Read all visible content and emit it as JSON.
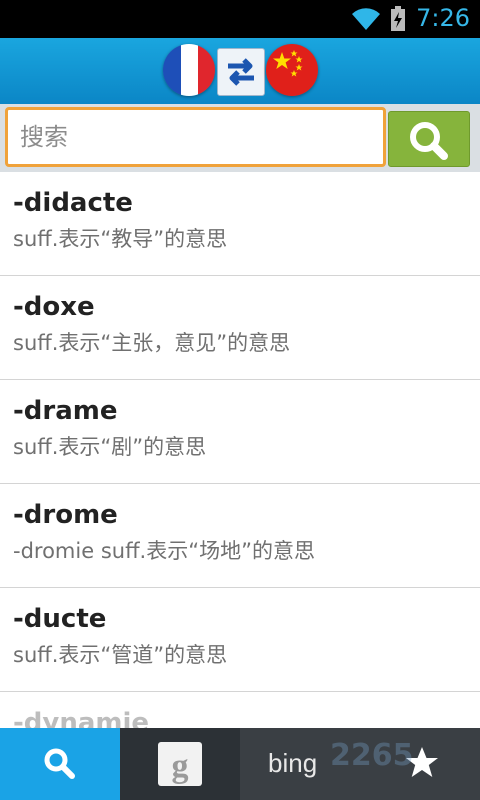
{
  "status_bar": {
    "time": "7:26",
    "icons": [
      "wifi-icon",
      "battery-charging-icon"
    ]
  },
  "header": {
    "source_flag": "france-flag-icon",
    "swap_icon": "swap-arrows-icon",
    "target_flag": "china-flag-icon",
    "accent_color": "#1aa6df"
  },
  "search": {
    "placeholder": "搜索",
    "value": "",
    "button_icon": "search-icon",
    "button_color": "#86b43c",
    "focus_border_color": "#f0a23a"
  },
  "entries": [
    {
      "word": "-didacte",
      "definition": "suff.表示“教导”的意思"
    },
    {
      "word": "-doxe",
      "definition": "suff.表示“主张，意见”的意思"
    },
    {
      "word": "-drame",
      "definition": "suff.表示“剧”的意思"
    },
    {
      "word": "-drome",
      "definition": "-dromie suff.表示“场地”的意思"
    },
    {
      "word": "-ducte",
      "definition": "suff.表示“管道”的意思"
    },
    {
      "word": "-dynamie",
      "definition": ""
    }
  ],
  "tabbar": {
    "tabs": [
      {
        "name": "search",
        "icon": "search-icon",
        "active": true
      },
      {
        "name": "google",
        "icon": "google-icon",
        "active": false
      },
      {
        "name": "bing",
        "label": "bing",
        "active": false
      },
      {
        "name": "favorites",
        "icon": "star-icon",
        "active": false
      }
    ],
    "active_color": "#1aa3e6",
    "watermark": "2265"
  }
}
